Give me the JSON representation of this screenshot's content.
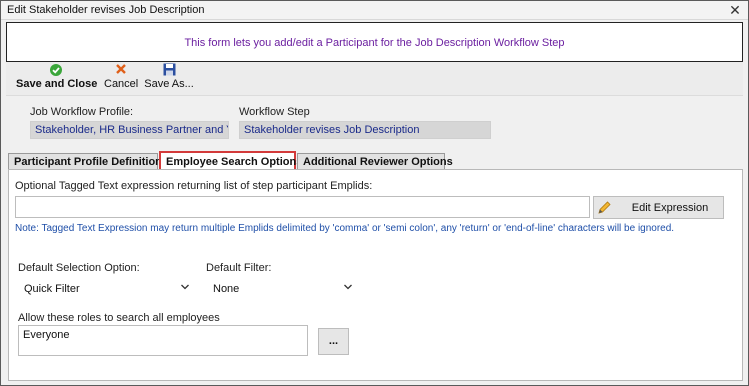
{
  "window": {
    "title": "Edit Stakeholder revises Job Description",
    "close_icon": "close-icon"
  },
  "banner": {
    "text": "This form lets you add/edit a Participant for the Job Description Workflow Step"
  },
  "toolbar": {
    "save_close_label": "Save and Close",
    "cancel_label": "Cancel",
    "save_as_label": "Save As...",
    "icons": [
      "checkmark-icon",
      "x-icon",
      "floppy-disk-icon"
    ]
  },
  "header_fields": {
    "profile_label": "Job Workflow Profile:",
    "profile_value": "Stakeholder, HR Business Partner and You",
    "step_label": "Workflow Step",
    "step_value": "Stakeholder revises Job Description"
  },
  "tabs": [
    {
      "label": "Participant Profile Definition",
      "active": false
    },
    {
      "label": "Employee Search Options",
      "active": true
    },
    {
      "label": "Additional Reviewer Options",
      "active": false
    }
  ],
  "search_options": {
    "expression_label": "Optional Tagged Text expression returning list of step participant Emplids:",
    "expression_value": "",
    "edit_expression_label": "Edit Expression",
    "note": "Note: Tagged Text Expression may return multiple Emplids delimited by 'comma' or 'semi colon', any 'return' or 'end-of-line' characters will be ignored.",
    "default_selection_label": "Default Selection Option:",
    "default_selection_value": "Quick Filter",
    "default_filter_label": "Default Filter:",
    "default_filter_value": "None",
    "roles_label": "Allow these roles to search all employees",
    "roles_value": "Everyone",
    "roles_button_label": "..."
  },
  "colors": {
    "banner_text": "#6b1fa0",
    "value_text": "#1a2a8a",
    "note_text": "#1f4fa8",
    "active_tab_border": "#d33a3a"
  }
}
